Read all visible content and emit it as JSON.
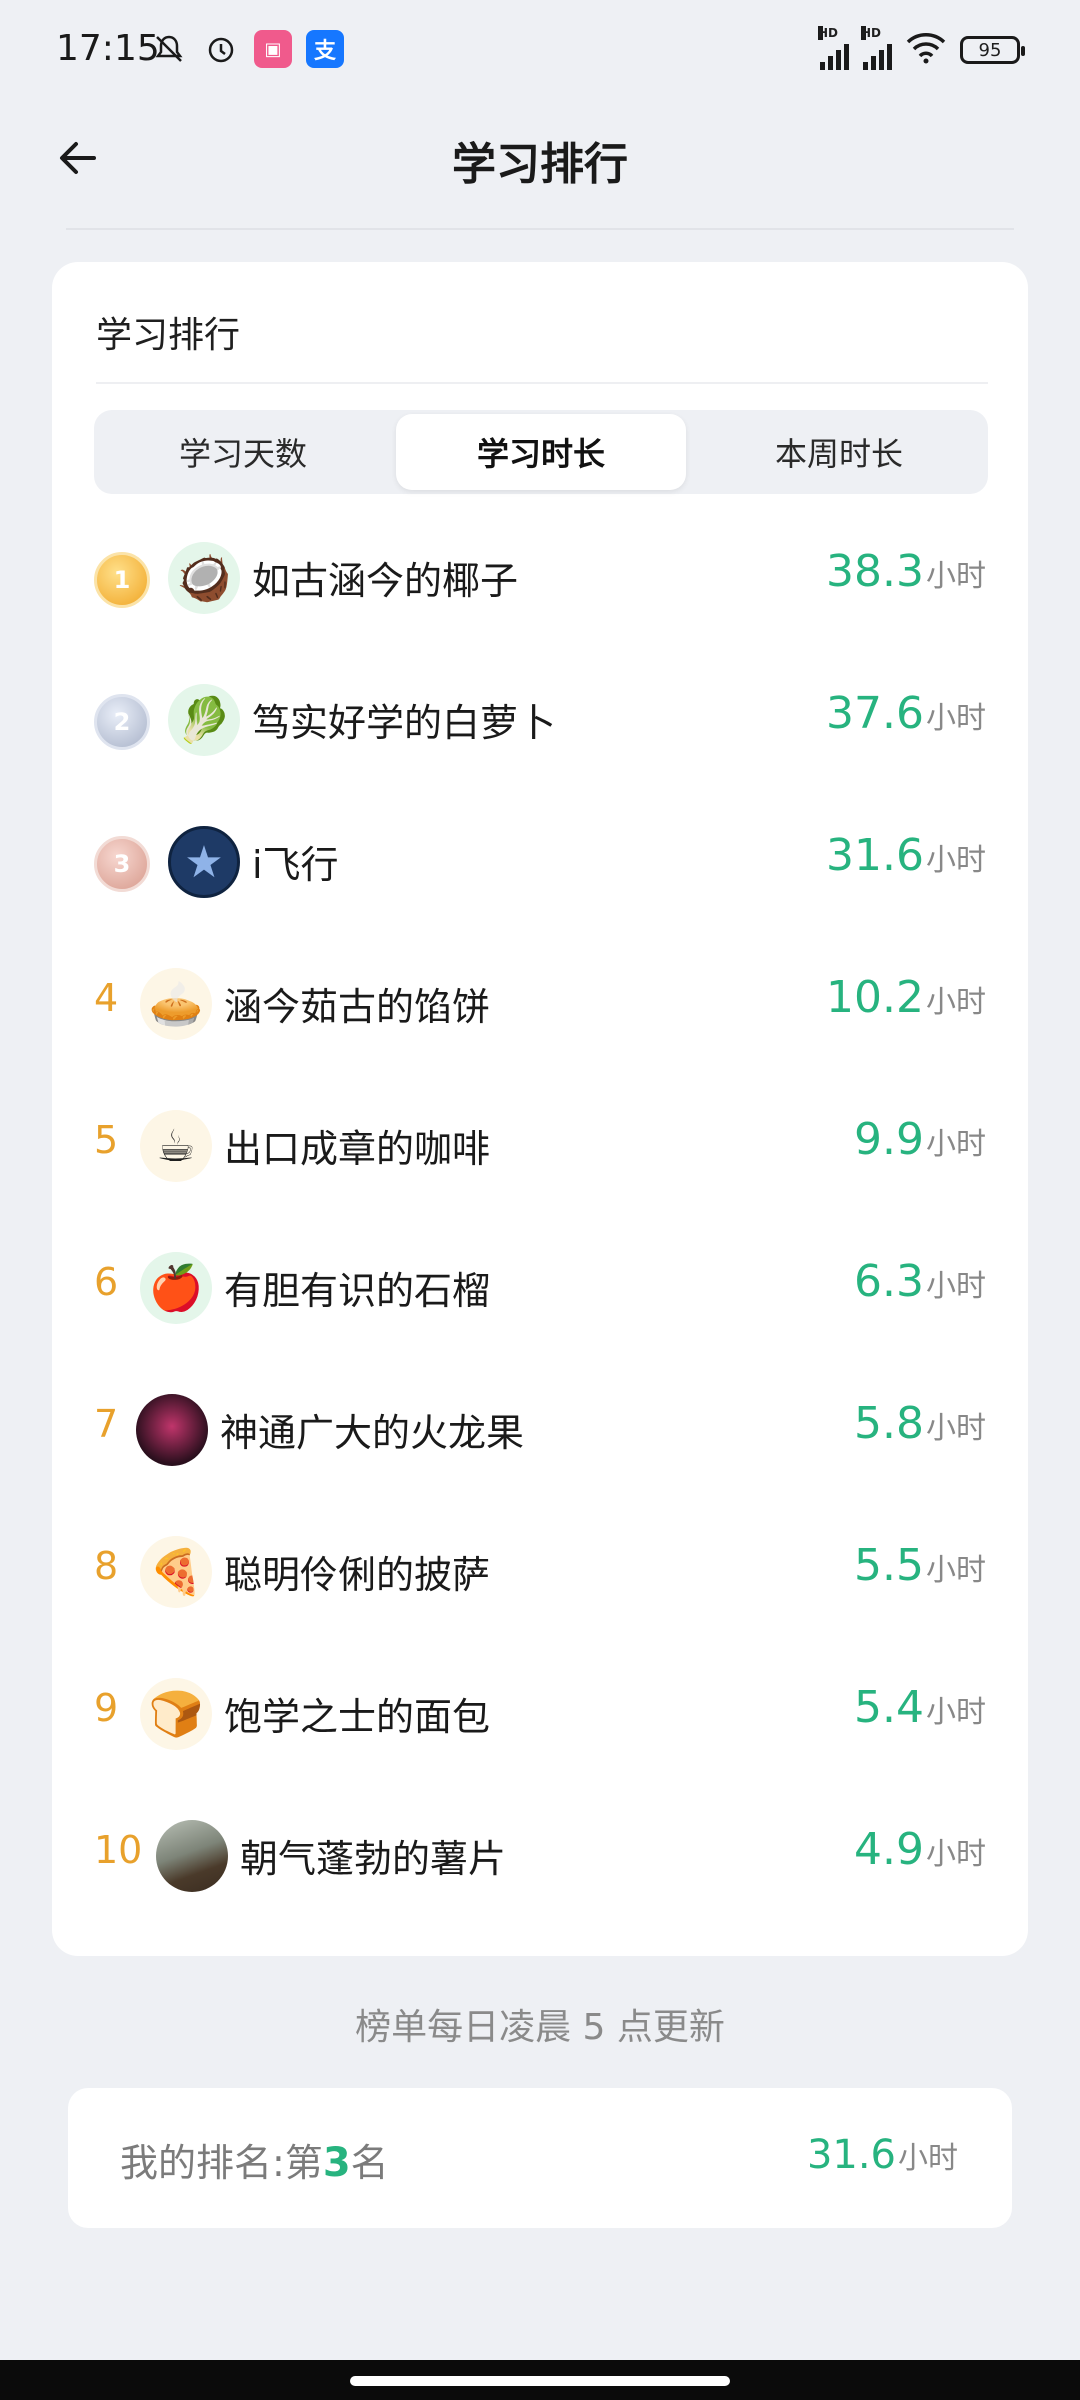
{
  "status_bar": {
    "time": "17:15",
    "icons": [
      "mute-icon",
      "alarm-icon",
      "app-icon",
      "alipay-icon"
    ],
    "signal_label": "HD",
    "battery": "95"
  },
  "header": {
    "title": "学习排行"
  },
  "card": {
    "title": "学习排行",
    "tabs": [
      {
        "label": "学习天数",
        "active": false
      },
      {
        "label": "学习时长",
        "active": true
      },
      {
        "label": "本周时长",
        "active": false
      }
    ],
    "rows": [
      {
        "rank": "1",
        "medal": true,
        "avatar_icon": "coconut-icon",
        "name": "如古涵今的椰子",
        "value": "38.3",
        "unit": "小时"
      },
      {
        "rank": "2",
        "medal": true,
        "avatar_icon": "radish-icon",
        "name": "笃实好学的白萝卜",
        "value": "37.6",
        "unit": "小时"
      },
      {
        "rank": "3",
        "medal": true,
        "avatar_icon": "star-badge-icon",
        "name": "i飞行",
        "value": "31.6",
        "unit": "小时"
      },
      {
        "rank": "4",
        "medal": false,
        "avatar_icon": "pie-icon",
        "name": "涵今茹古的馅饼",
        "value": "10.2",
        "unit": "小时"
      },
      {
        "rank": "5",
        "medal": false,
        "avatar_icon": "coffee-icon",
        "name": "出口成章的咖啡",
        "value": "9.9",
        "unit": "小时"
      },
      {
        "rank": "6",
        "medal": false,
        "avatar_icon": "pomegranate-icon",
        "name": "有胆有识的石榴",
        "value": "6.3",
        "unit": "小时"
      },
      {
        "rank": "7",
        "medal": false,
        "avatar_icon": "dragonfruit-icon",
        "name": "神通广大的火龙果",
        "value": "5.8",
        "unit": "小时"
      },
      {
        "rank": "8",
        "medal": false,
        "avatar_icon": "pizza-icon",
        "name": "聪明伶俐的披萨",
        "value": "5.5",
        "unit": "小时"
      },
      {
        "rank": "9",
        "medal": false,
        "avatar_icon": "bread-icon",
        "name": "饱学之士的面包",
        "value": "5.4",
        "unit": "小时"
      },
      {
        "rank": "10",
        "medal": false,
        "avatar_icon": "dog-photo-icon",
        "name": "朝气蓬勃的薯片",
        "value": "4.9",
        "unit": "小时"
      }
    ]
  },
  "update_note": "榜单每日凌晨 5 点更新",
  "my_rank": {
    "label_prefix": "我的排名:第",
    "rank": "3",
    "label_suffix": "名",
    "value": "31.6",
    "unit": "小时"
  },
  "colors": {
    "accent_green": "#27b37f",
    "rank_orange": "#e8a12c",
    "background": "#eef0f4"
  }
}
